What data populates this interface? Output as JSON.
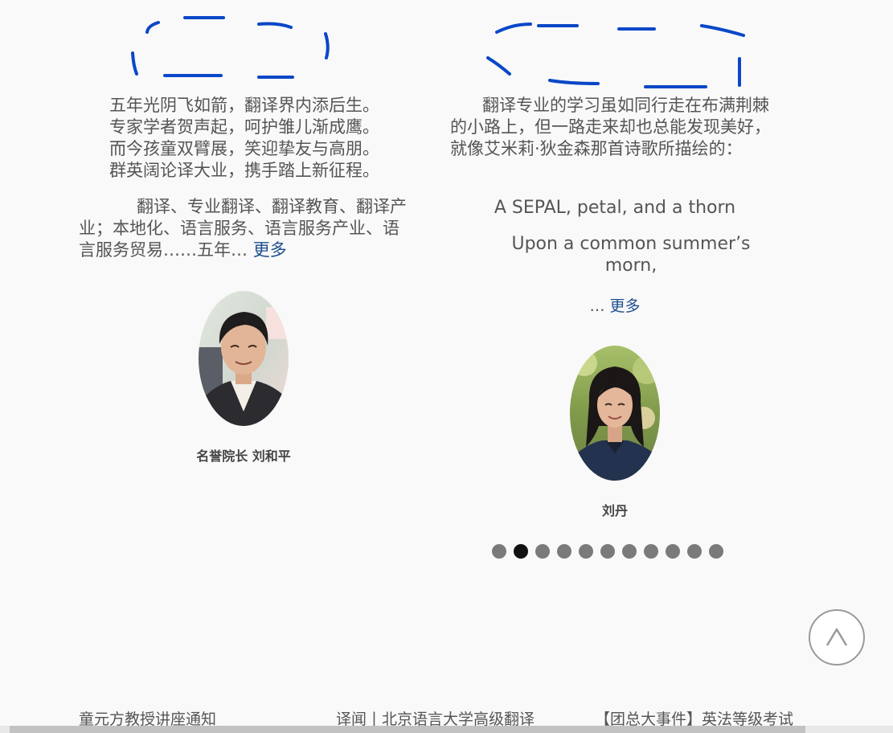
{
  "left_card": {
    "poem": [
      "五年光阴飞如箭，翻译界内添后生。",
      "专家学者贺声起，呵护雏儿渐成鹰。",
      "而今孩童双臂展，笑迎挚友与高朋。",
      "群英阔论译大业，携手踏上新征程。"
    ],
    "excerpt": "翻译、专业翻译、翻译教育、翻译产业；本地化、语言服务、语言服务产业、语言服务贸易……五年…",
    "more_label": "更多",
    "caption": "名誉院长 刘和平"
  },
  "right_card": {
    "excerpt": "翻译专业的学习虽如同行走在布满荆棘的小路上，但一路走来却也总能发现美好，就像艾米莉·狄金森那首诗歌所描绘的：",
    "quote_line_1": "A SEPAL, petal, and a thorn",
    "quote_line_2": "Upon a common summer’s morn,",
    "ellipsis": "…",
    "more_label": "更多",
    "caption": "刘丹"
  },
  "carousel": {
    "dot_count": 11,
    "active_index": 1
  },
  "news": [
    "童元方教授讲座通知",
    "译闻丨北京语言大学高级翻译",
    "【团总大事件】英法等级考试"
  ],
  "colors": {
    "text": "#555555",
    "link": "#1d4e8f",
    "scribble": "#0a47c8",
    "dot": "#7a7a7a",
    "dot_active": "#111111"
  },
  "icons": {
    "back_to_top": "chevron-up-icon"
  }
}
